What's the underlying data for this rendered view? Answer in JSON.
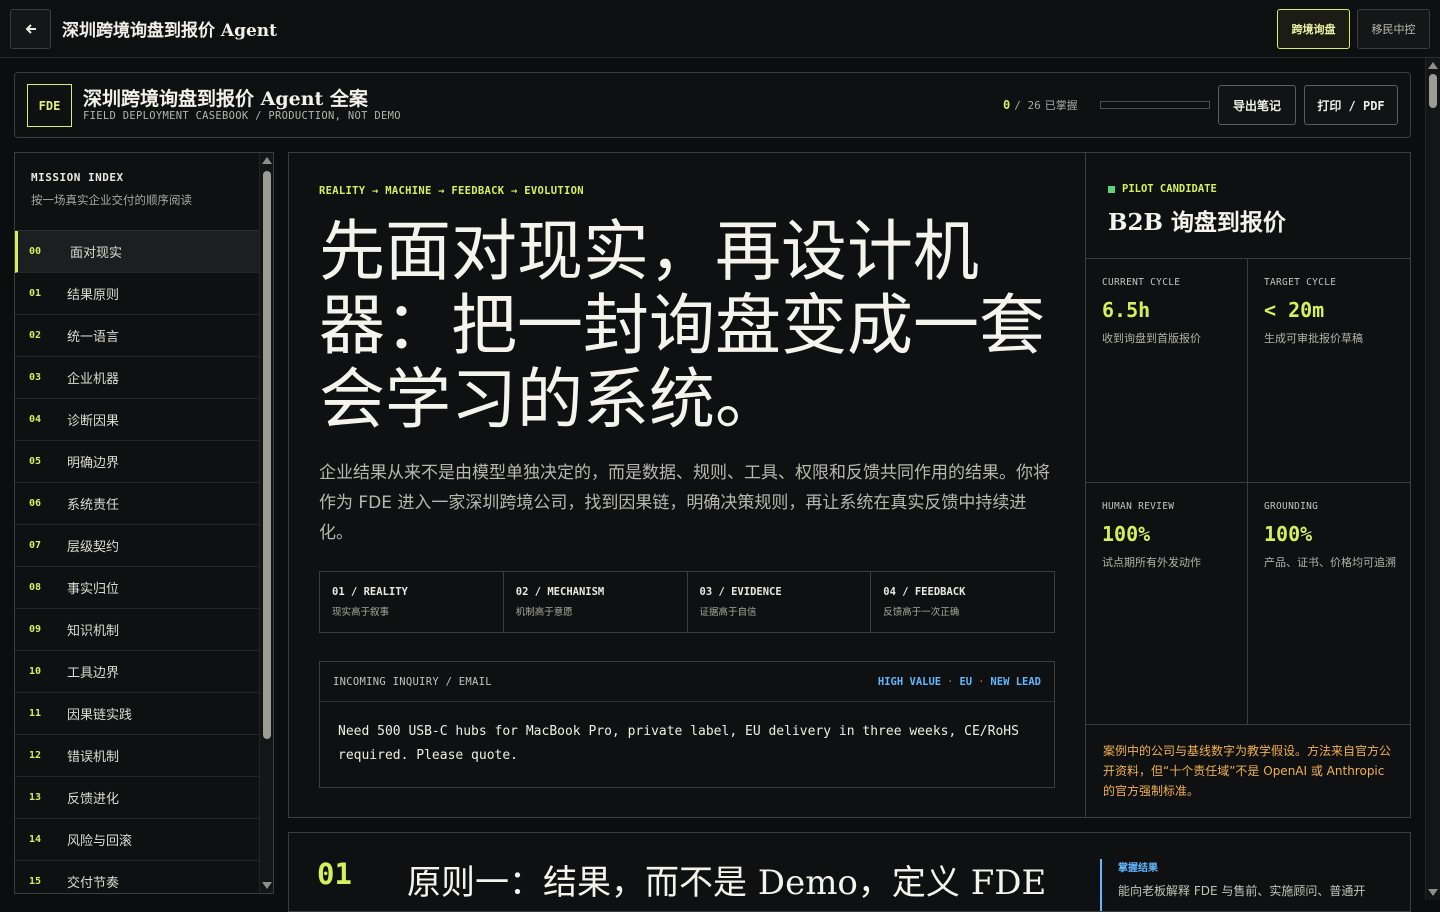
{
  "topbar": {
    "title": "深圳跨境询盘到报价 Agent",
    "buttons": [
      {
        "label": "跨境询盘",
        "active": true
      },
      {
        "label": "移民中控",
        "active": false
      }
    ]
  },
  "header": {
    "badge": "FDE",
    "title": "深圳跨境询盘到报价 Agent 全案",
    "subtitle": "FIELD DEPLOYMENT CASEBOOK / PRODUCTION, NOT DEMO",
    "progress": {
      "done": "0",
      "total": "/ 26",
      "label": "已掌握",
      "fraction": 0
    },
    "export_label": "导出笔记",
    "print_label": "打印 / PDF"
  },
  "sidebar": {
    "title": "MISSION INDEX",
    "desc": "按一场真实企业交付的顺序阅读",
    "items": [
      {
        "num": "00",
        "label": "面对现实",
        "active": true
      },
      {
        "num": "01",
        "label": "结果原则"
      },
      {
        "num": "02",
        "label": "统一语言"
      },
      {
        "num": "03",
        "label": "企业机器"
      },
      {
        "num": "04",
        "label": "诊断因果"
      },
      {
        "num": "05",
        "label": "明确边界"
      },
      {
        "num": "06",
        "label": "系统责任"
      },
      {
        "num": "07",
        "label": "层级契约"
      },
      {
        "num": "08",
        "label": "事实归位"
      },
      {
        "num": "09",
        "label": "知识机制"
      },
      {
        "num": "10",
        "label": "工具边界"
      },
      {
        "num": "11",
        "label": "因果链实践"
      },
      {
        "num": "12",
        "label": "错误机制"
      },
      {
        "num": "13",
        "label": "反馈进化"
      },
      {
        "num": "14",
        "label": "风险与回滚"
      },
      {
        "num": "15",
        "label": "交付节奏"
      }
    ]
  },
  "hero": {
    "tags": "REALITY → MACHINE → FEEDBACK → EVOLUTION",
    "title": "先面对现实，再设计机器：把一封询盘变成一套会学习的系统。",
    "desc": "企业结果从来不是由模型单独决定的，而是数据、规则、工具、权限和反馈共同作用的结果。你将作为 FDE 进入一家深圳跨境公司，找到因果链，明确决策规则，再让系统在真实反馈中持续进化。",
    "pillars": [
      {
        "title": "01 / REALITY",
        "sub": "现实高于叙事"
      },
      {
        "title": "02 / MECHANISM",
        "sub": "机制高于意愿"
      },
      {
        "title": "03 / EVIDENCE",
        "sub": "证据高于自信"
      },
      {
        "title": "04 / FEEDBACK",
        "sub": "反馈高于一次正确"
      }
    ],
    "inquiry": {
      "label": "INCOMING INQUIRY / EMAIL",
      "tag1": "HIGH VALUE",
      "sep1": "·",
      "tag2": "EU",
      "sep2": "·",
      "tag3": "NEW LEAD",
      "body": "Need 500 USB-C hubs for MacBook Pro, private label, EU delivery in three weeks, CE/RoHS required. Please quote."
    }
  },
  "pilot": {
    "tag": "PILOT CANDIDATE",
    "title": "B2B 询盘到报价",
    "metrics": [
      {
        "label": "CURRENT CYCLE",
        "value": "6.5h",
        "desc": "收到询盘到首版报价"
      },
      {
        "label": "TARGET CYCLE",
        "value": "< 20m",
        "desc": "生成可审批报价草稿"
      },
      {
        "label": "HUMAN REVIEW",
        "value": "100%",
        "desc": "试点期所有外发动作"
      },
      {
        "label": "GROUNDING",
        "value": "100%",
        "desc": "产品、证书、价格均可追溯"
      }
    ],
    "note": "案例中的公司与基线数字为教学假设。方法来自官方公开资料，但“十个责任域”不是 OpenAI 或 Anthropic 的官方强制标准。"
  },
  "section": {
    "num": "01",
    "title": "原则一：结果，而不是 Demo，定义 FDE",
    "side_tag": "掌握结果",
    "side_text": "能向老板解释 FDE 与售前、实施顾问、普通开"
  },
  "colors": {
    "accent": "#d6ef5b",
    "info": "#60b6ff",
    "warning": "#f0b050",
    "pilot_dot": "#5fcf7a"
  }
}
